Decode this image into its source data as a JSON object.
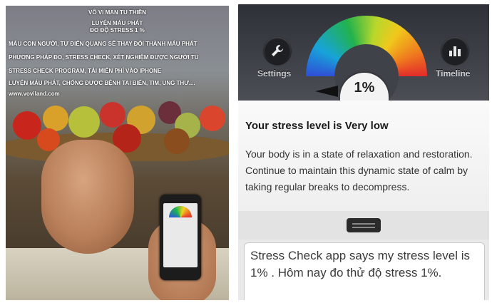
{
  "left_photo": {
    "caption_lines": [
      "VÔ VI MAN TU THIỀN",
      "LUYỆN MÁU PHÁT",
      "ĐO ĐỘ STRESS 1 %",
      "MÁU CON NGƯỜI, TỰ ĐIỂN QUANG SẼ THAY ĐỔI THÀNH MÁU PHÁT",
      "PHƯƠNG PHÁP ĐO, STRESS CHECK, XÉT NGHIỆM ĐƯỢC NGƯỜI TU",
      "STRESS CHECK PROGRAM, TẢI MIỄN PHÍ VÀO IPHONE",
      "LUYỆN MÁU PHÁT, CHỐNG ĐƯỢC BỆNH TAI BIẾN, TIM, UNG THƯ....",
      "www.voviland.com"
    ]
  },
  "app": {
    "settings_label": "Settings",
    "timeline_label": "Timeline",
    "gauge_percent": "1%",
    "gauge_level_fraction": 0.01,
    "status_title": "Your stress level is Very low",
    "status_body": "Your body is in a state of relaxation and restoration. Continue to maintain this dynamic state of calm by taking regular breaks to decompress.",
    "comment_text": "Stress Check app says my stress level is 1% . Hôm nay đo thử độ stress 1%."
  },
  "colors": {
    "gauge_low": "#2f4fd6",
    "gauge_mid": "#22b24c",
    "gauge_high": "#e32b2b",
    "topbar": "#3f4349"
  }
}
